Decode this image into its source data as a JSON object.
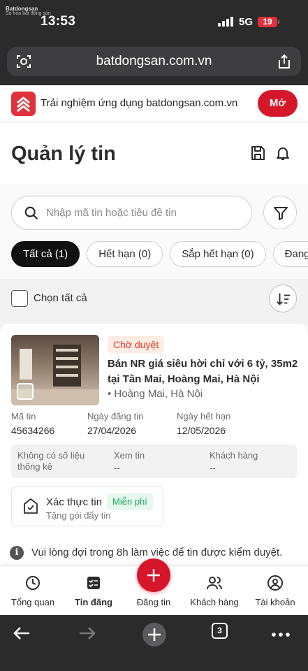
{
  "status_bar": {
    "time": "13:53",
    "network": "5G",
    "battery": "19",
    "watermark_top": "Batdongsan",
    "watermark_bottom": "Só hóa bất động sản"
  },
  "browser": {
    "url": "batdongsan.com.vn",
    "tab_count": "3"
  },
  "app_banner": {
    "text": "Trải nghiệm ứng dụng batdongsan.com.vn",
    "open_label": "Mở",
    "brand_color": "#d5162b"
  },
  "header": {
    "title": "Quản lý tin"
  },
  "search": {
    "placeholder": "Nhập mã tin hoặc tiêu đề tin"
  },
  "tabs": [
    {
      "label": "Tất cả (1)",
      "active": true
    },
    {
      "label": "Hết hạn (0)",
      "active": false
    },
    {
      "label": "Sắp hết hạn (0)",
      "active": false
    },
    {
      "label": "Đang hiển thị",
      "active": false
    }
  ],
  "select_all": {
    "label": "Chọn tất cả"
  },
  "listing": {
    "status": "Chờ duyệt",
    "title": "Bán NR giá siêu hời chỉ với 6 tỷ, 35m2 tại Tân Mai, Hoàng Mai, Hà Nội",
    "location": "• Hoàng Mai, Hà Nội",
    "code_label": "Mã tin",
    "code": "45634266",
    "posted_label": "Ngày đăng tin",
    "posted": "27/04/2026",
    "expiry_label": "Ngày hết hạn",
    "expiry": "12/05/2026",
    "stats": {
      "no_data": "Không có số liệu thống kê",
      "views_label": "Xem tin",
      "views": "--",
      "customers_label": "Khách hàng",
      "customers": "--"
    },
    "verify": {
      "title": "Xác thực tin",
      "badge": "Miễn phí",
      "subtitle": "Tặng gói đẩy tin"
    }
  },
  "note": {
    "text": "Vui lòng đợi trong 8h làm việc để tin được kiểm duyệt."
  },
  "bottom_nav": {
    "items": [
      {
        "label": "Tổng quan",
        "icon": "clock-icon"
      },
      {
        "label": "Tin đăng",
        "icon": "checklist-icon",
        "active": true
      },
      {
        "label": "Đăng tin",
        "icon": "plus-icon"
      },
      {
        "label": "Khách hàng",
        "icon": "users-icon"
      },
      {
        "label": "Tài khoản",
        "icon": "user-circle-icon"
      }
    ]
  }
}
